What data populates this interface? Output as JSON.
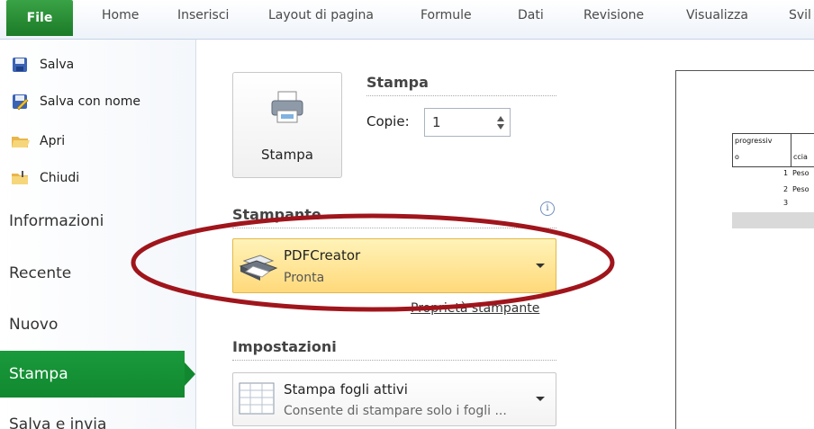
{
  "ribbon": {
    "file_tab": "File",
    "tabs": [
      "Home",
      "Inserisci",
      "Layout di pagina",
      "Formule",
      "Dati",
      "Revisione",
      "Visualizza",
      "Svil"
    ]
  },
  "backstage": {
    "commands": [
      {
        "label": "Salva",
        "icon": "save-icon"
      },
      {
        "label": "Salva con nome",
        "icon": "save-as-icon"
      },
      {
        "label": "Apri",
        "icon": "open-folder-icon"
      },
      {
        "label": "Chiudi",
        "icon": "close-folder-icon"
      }
    ],
    "sections": [
      "Informazioni",
      "Recente",
      "Nuovo",
      "Stampa",
      "Salva e invia"
    ],
    "selected_section": "Stampa"
  },
  "print": {
    "button_label": "Stampa",
    "heading": "Stampa",
    "copies_label": "Copie:",
    "copies_value": "1",
    "printer_heading": "Stampante",
    "printer_name": "PDFCreator",
    "printer_status": "Pronta",
    "printer_properties_link": "Proprietà stampante",
    "settings_heading": "Impostazioni",
    "settings_option": "Stampa fogli attivi",
    "settings_option_desc": "Consente di stampare solo i fogli ..."
  },
  "preview": {
    "header_cells": [
      "progressiv",
      "o",
      "ccia"
    ],
    "rows": [
      {
        "num": "1",
        "text": "Peso"
      },
      {
        "num": "2",
        "text": "Peso"
      },
      {
        "num": "3",
        "text": ""
      }
    ]
  },
  "colors": {
    "file_tab": "#1f8a2c",
    "selected_nav": "#139236",
    "printer_dropdown": "#ffe48a",
    "annotation": "#a0151c"
  }
}
